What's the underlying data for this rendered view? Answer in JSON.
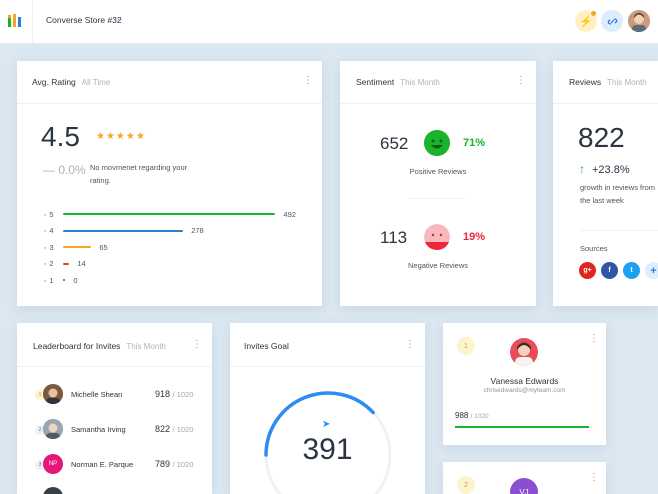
{
  "header": {
    "store_name": "Converse Store #32",
    "chevron": "chevron-down-icon",
    "actions": [
      "bolt-icon",
      "link-icon",
      "user-avatar"
    ]
  },
  "avg_rating": {
    "title": "Avg. Rating",
    "period": "All Time",
    "value": "4.5",
    "stars": "★★★★★",
    "change": "— 0.0%",
    "note": "No movmenet regarding your rating.",
    "rows": [
      {
        "star": "5",
        "count": "492",
        "color": "#19b32c",
        "fraction": 1.0
      },
      {
        "star": "4",
        "count": "278",
        "color": "#2d7ed6",
        "fraction": 0.565
      },
      {
        "star": "3",
        "count": "65",
        "color": "#f5a623",
        "fraction": 0.132
      },
      {
        "star": "2",
        "count": "14",
        "color": "#e8481c",
        "fraction": 0.028
      },
      {
        "star": "1",
        "count": "0",
        "color": "#e0202d",
        "fraction": 0.0
      }
    ]
  },
  "sentiment": {
    "title": "Sentiment",
    "period": "This Month",
    "positive_count": "652",
    "positive_pct": "71%",
    "positive_label": "Positive Reviews",
    "negative_count": "113",
    "negative_pct": "19%",
    "negative_label": "Negative Reviews",
    "positive_color": "#19b32c",
    "negative_color": "#f0243b"
  },
  "reviews": {
    "title": "Reviews",
    "period": "This Month",
    "value": "822",
    "change": "+23.8%",
    "note": "growth in reviews from the last week",
    "sources_label": "Sources",
    "sources": [
      {
        "label": "g+",
        "color": "#e0261c"
      },
      {
        "label": "f",
        "color": "#2f55a4"
      },
      {
        "label": "t",
        "color": "#1da1f2"
      },
      {
        "label": "+",
        "color": "#dceefe"
      }
    ]
  },
  "leaderboard": {
    "title": "Leaderboard for Invites",
    "period": "This Month",
    "rows": [
      {
        "rank": "1",
        "name": "Michelle Shean",
        "score": "918",
        "total": "/ 1020",
        "initials": ""
      },
      {
        "rank": "2",
        "name": "Samantha Irving",
        "score": "822",
        "total": "/ 1020",
        "initials": ""
      },
      {
        "rank": "3",
        "name": "Norman E. Parque",
        "score": "789",
        "total": "/ 1020",
        "initials": "NP"
      }
    ]
  },
  "invites_goal": {
    "title": "Invites Goal",
    "value": "391",
    "progress": 0.38
  },
  "profile": {
    "rank": "1",
    "name": "Vanessa Edwards",
    "email": "chrisedwards@myteam.com",
    "score": "988",
    "total": "/ 1020",
    "progress": 0.97,
    "next_rank": "2",
    "next_initials": "VJ"
  }
}
